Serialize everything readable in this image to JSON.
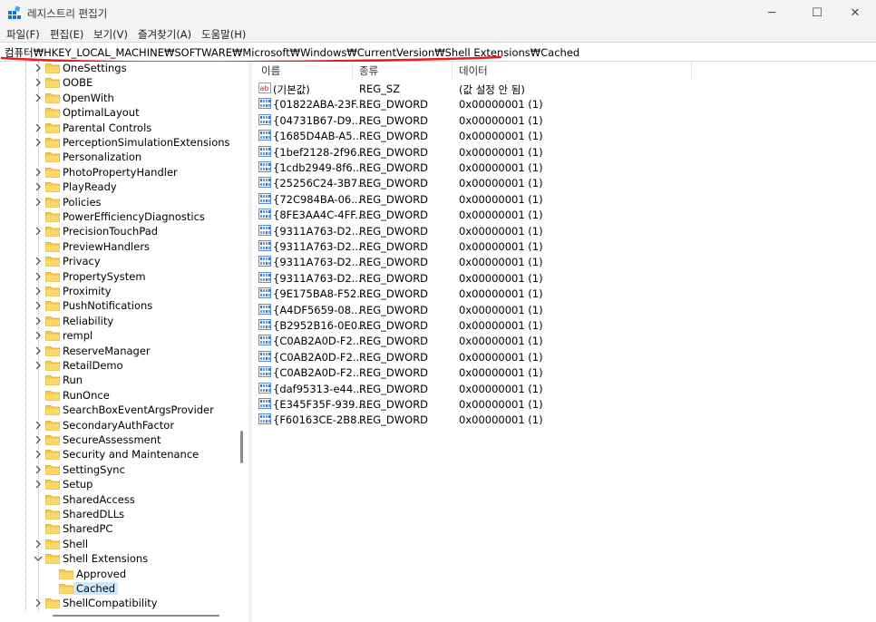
{
  "window": {
    "title": "레지스트리 편집기",
    "buttons": [
      "─",
      "☐",
      "✕"
    ]
  },
  "menu": [
    "파일(F)",
    "편집(E)",
    "보기(V)",
    "즐겨찾기(A)",
    "도움말(H)"
  ],
  "address": "컴퓨터₩HKEY_LOCAL_MACHINE₩SOFTWARE₩Microsoft₩Windows₩CurrentVersion₩Shell Extensions₩Cached",
  "tree": {
    "items": [
      {
        "label": "OneSettings",
        "expandable": true
      },
      {
        "label": "OOBE",
        "expandable": true
      },
      {
        "label": "OpenWith",
        "expandable": true
      },
      {
        "label": "OptimalLayout",
        "expandable": false
      },
      {
        "label": "Parental Controls",
        "expandable": true
      },
      {
        "label": "PerceptionSimulationExtensions",
        "expandable": true
      },
      {
        "label": "Personalization",
        "expandable": false
      },
      {
        "label": "PhotoPropertyHandler",
        "expandable": true
      },
      {
        "label": "PlayReady",
        "expandable": true
      },
      {
        "label": "Policies",
        "expandable": true
      },
      {
        "label": "PowerEfficiencyDiagnostics",
        "expandable": false
      },
      {
        "label": "PrecisionTouchPad",
        "expandable": true
      },
      {
        "label": "PreviewHandlers",
        "expandable": false
      },
      {
        "label": "Privacy",
        "expandable": true
      },
      {
        "label": "PropertySystem",
        "expandable": true
      },
      {
        "label": "Proximity",
        "expandable": true
      },
      {
        "label": "PushNotifications",
        "expandable": true
      },
      {
        "label": "Reliability",
        "expandable": true
      },
      {
        "label": "rempl",
        "expandable": true
      },
      {
        "label": "ReserveManager",
        "expandable": true
      },
      {
        "label": "RetailDemo",
        "expandable": true
      },
      {
        "label": "Run",
        "expandable": false
      },
      {
        "label": "RunOnce",
        "expandable": false
      },
      {
        "label": "SearchBoxEventArgsProvider",
        "expandable": false
      },
      {
        "label": "SecondaryAuthFactor",
        "expandable": true
      },
      {
        "label": "SecureAssessment",
        "expandable": true
      },
      {
        "label": "Security and Maintenance",
        "expandable": true
      },
      {
        "label": "SettingSync",
        "expandable": true
      },
      {
        "label": "Setup",
        "expandable": true
      },
      {
        "label": "SharedAccess",
        "expandable": false
      },
      {
        "label": "SharedDLLs",
        "expandable": false
      },
      {
        "label": "SharedPC",
        "expandable": false
      },
      {
        "label": "Shell",
        "expandable": true
      },
      {
        "label": "Shell Extensions",
        "expandable": true,
        "expanded": true
      },
      {
        "label": "Approved",
        "expandable": false,
        "child": true
      },
      {
        "label": "Cached",
        "expandable": false,
        "child": true,
        "selected": true
      },
      {
        "label": "ShellCompatibility",
        "expandable": true
      }
    ]
  },
  "list": {
    "columns": [
      "이름",
      "종류",
      "데이터"
    ],
    "rows": [
      {
        "icon": "ab",
        "name": "(기본값)",
        "type": "REG_SZ",
        "data": "(값 설정 안 됨)"
      },
      {
        "icon": "bin",
        "name": "{01822ABA-23F...",
        "type": "REG_DWORD",
        "data": "0x00000001 (1)"
      },
      {
        "icon": "bin",
        "name": "{04731B67-D9...",
        "type": "REG_DWORD",
        "data": "0x00000001 (1)"
      },
      {
        "icon": "bin",
        "name": "{1685D4AB-A5...",
        "type": "REG_DWORD",
        "data": "0x00000001 (1)"
      },
      {
        "icon": "bin",
        "name": "{1bef2128-2f96...",
        "type": "REG_DWORD",
        "data": "0x00000001 (1)"
      },
      {
        "icon": "bin",
        "name": "{1cdb2949-8f6...",
        "type": "REG_DWORD",
        "data": "0x00000001 (1)"
      },
      {
        "icon": "bin",
        "name": "{25256C24-3B7...",
        "type": "REG_DWORD",
        "data": "0x00000001 (1)"
      },
      {
        "icon": "bin",
        "name": "{72C984BA-06...",
        "type": "REG_DWORD",
        "data": "0x00000001 (1)"
      },
      {
        "icon": "bin",
        "name": "{8FE3AA4C-4FF...",
        "type": "REG_DWORD",
        "data": "0x00000001 (1)"
      },
      {
        "icon": "bin",
        "name": "{9311A763-D2...",
        "type": "REG_DWORD",
        "data": "0x00000001 (1)"
      },
      {
        "icon": "bin",
        "name": "{9311A763-D2...",
        "type": "REG_DWORD",
        "data": "0x00000001 (1)"
      },
      {
        "icon": "bin",
        "name": "{9311A763-D2...",
        "type": "REG_DWORD",
        "data": "0x00000001 (1)"
      },
      {
        "icon": "bin",
        "name": "{9311A763-D2...",
        "type": "REG_DWORD",
        "data": "0x00000001 (1)"
      },
      {
        "icon": "bin",
        "name": "{9E175BA8-F52...",
        "type": "REG_DWORD",
        "data": "0x00000001 (1)"
      },
      {
        "icon": "bin",
        "name": "{A4DF5659-08...",
        "type": "REG_DWORD",
        "data": "0x00000001 (1)"
      },
      {
        "icon": "bin",
        "name": "{B2952B16-0E0...",
        "type": "REG_DWORD",
        "data": "0x00000001 (1)"
      },
      {
        "icon": "bin",
        "name": "{C0AB2A0D-F2...",
        "type": "REG_DWORD",
        "data": "0x00000001 (1)"
      },
      {
        "icon": "bin",
        "name": "{C0AB2A0D-F2...",
        "type": "REG_DWORD",
        "data": "0x00000001 (1)"
      },
      {
        "icon": "bin",
        "name": "{C0AB2A0D-F2...",
        "type": "REG_DWORD",
        "data": "0x00000001 (1)"
      },
      {
        "icon": "bin",
        "name": "{daf95313-e44...",
        "type": "REG_DWORD",
        "data": "0x00000001 (1)"
      },
      {
        "icon": "bin",
        "name": "{E345F35F-939...",
        "type": "REG_DWORD",
        "data": "0x00000001 (1)"
      },
      {
        "icon": "bin",
        "name": "{F60163CE-2B8...",
        "type": "REG_DWORD",
        "data": "0x00000001 (1)"
      }
    ]
  },
  "colors": {
    "selection": "#cce8ff",
    "folder": "#f7c948",
    "annotation": "#e02020"
  }
}
